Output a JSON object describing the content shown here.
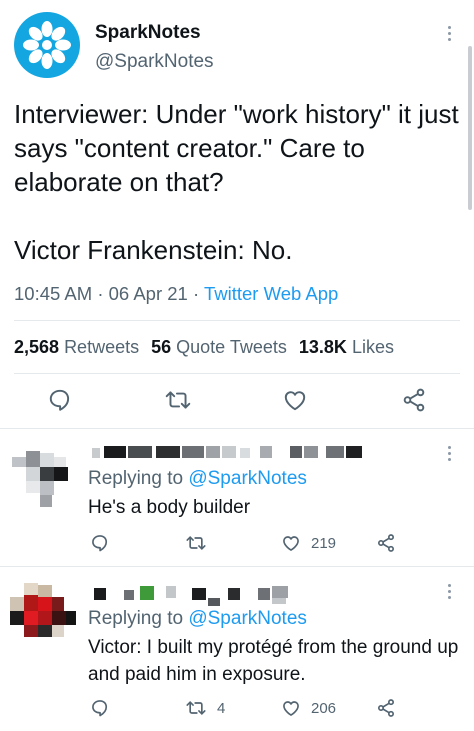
{
  "tweet": {
    "author_name": "SparkNotes",
    "author_handle": "@SparkNotes",
    "text": "Interviewer: Under \"work history\" it just says \"content creator.\" Care to elaborate on that?\n\nVictor Frankenstein: No.",
    "time": "10:45 AM",
    "date": "06 Apr 21",
    "separator": "·",
    "source_app": "Twitter Web App",
    "stats": {
      "retweets_count": "2,568",
      "retweets_label": "Retweets",
      "quote_count": "56",
      "quote_label": "Quote Tweets",
      "likes_count": "13.8K",
      "likes_label": "Likes"
    },
    "actions": [
      "reply-icon",
      "retweet-icon",
      "like-icon",
      "share-icon"
    ]
  },
  "replies": [
    {
      "replying_label": "Replying to",
      "replying_to": "@SparkNotes",
      "text": "He's a body builder",
      "retweet_count": "",
      "like_count": "219"
    },
    {
      "replying_label": "Replying to",
      "replying_to": "@SparkNotes",
      "text": "Victor: I built my protégé from the ground up and paid him in exposure.",
      "retweet_count": "4",
      "like_count": "206"
    }
  ],
  "colors": {
    "brand_avatar": "#14a6e0",
    "link": "#1d9bf0",
    "muted": "#536471",
    "text": "#0f1419"
  }
}
